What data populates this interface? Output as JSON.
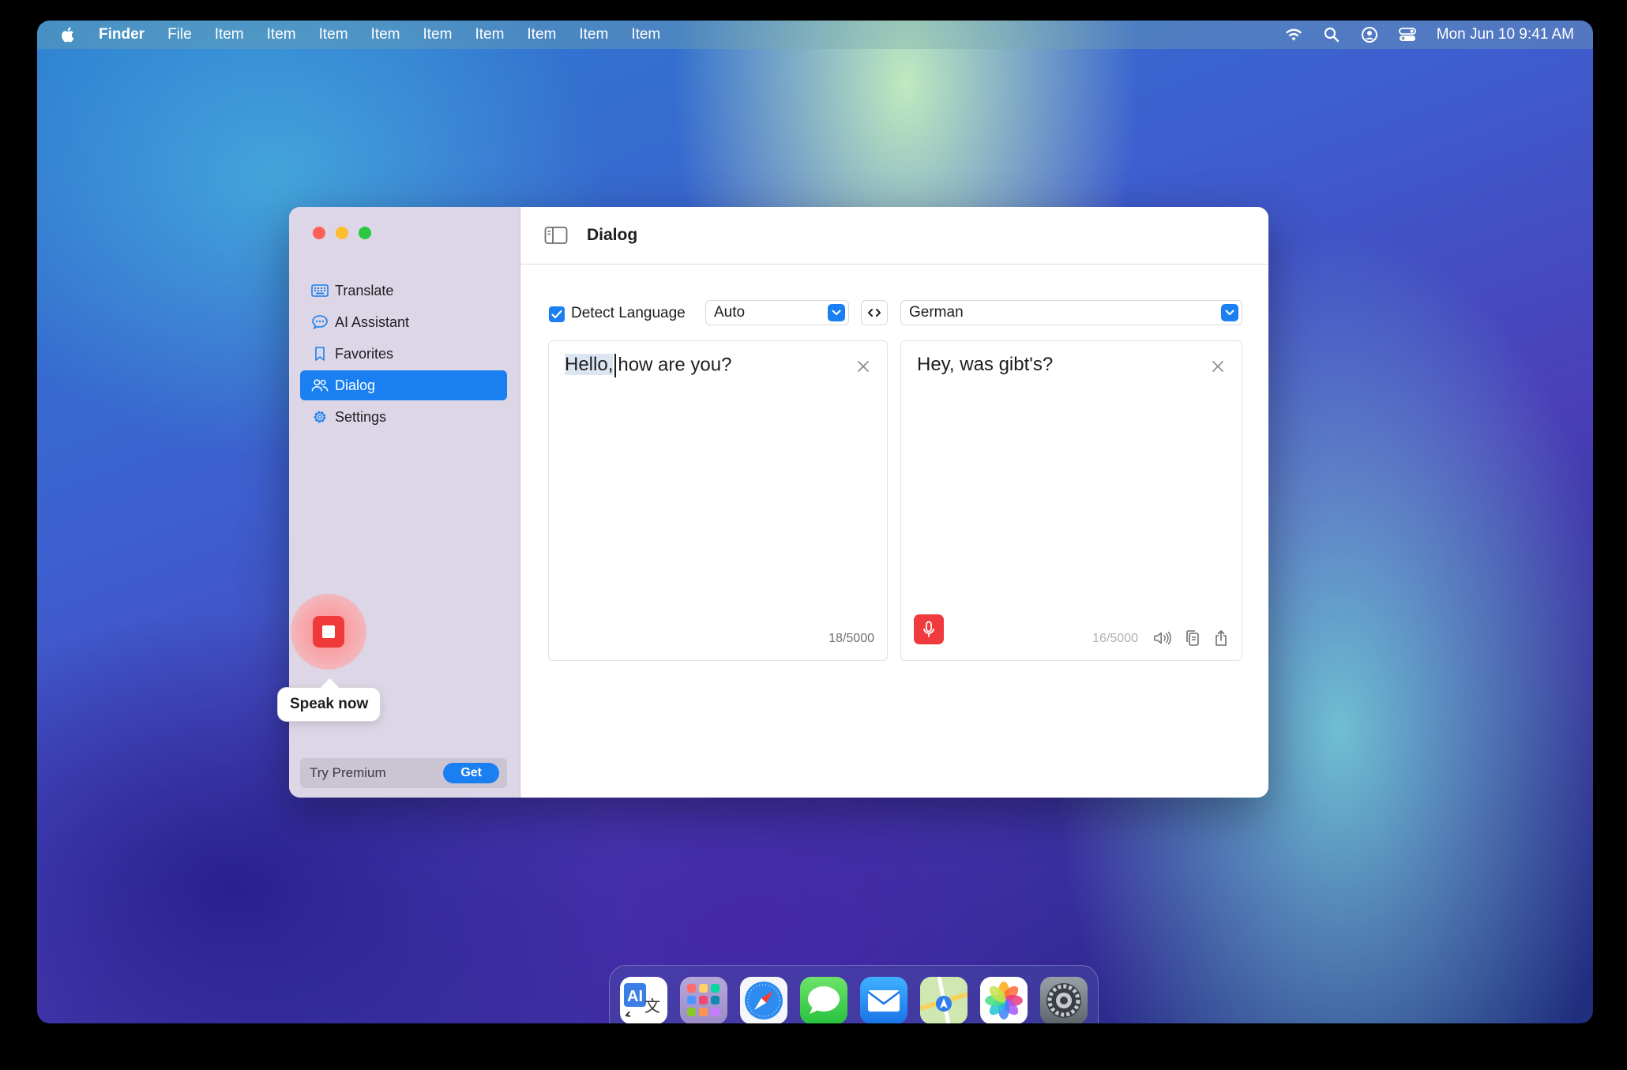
{
  "menubar": {
    "app_name": "Finder",
    "items": [
      "File",
      "Item",
      "Item",
      "Item",
      "Item",
      "Item",
      "Item",
      "Item",
      "Item",
      "Item"
    ],
    "clock": "Mon Jun 10  9:41 AM"
  },
  "window": {
    "title": "Dialog",
    "sidebar": {
      "items": [
        {
          "label": "Translate",
          "icon": "keyboard-icon"
        },
        {
          "label": "AI Assistant",
          "icon": "chat-bubble-icon"
        },
        {
          "label": "Favorites",
          "icon": "bookmark-icon"
        },
        {
          "label": "Dialog",
          "icon": "people-icon",
          "active": true
        },
        {
          "label": "Settings",
          "icon": "gear-icon"
        }
      ],
      "premium": {
        "label": "Try Premium",
        "button": "Get"
      }
    },
    "languages": {
      "detect_label": "Detect Language",
      "detect_checked": true,
      "source": "Auto",
      "target": "German"
    },
    "source_panel": {
      "highlighted": "Hello,",
      "rest": "how are you?",
      "count": "18/5000"
    },
    "target_panel": {
      "text": "Hey, was gibt's?",
      "count": "16/5000"
    },
    "tooltip": "Speak now"
  },
  "dock": {
    "apps": [
      "translate-app-icon",
      "launchpad-icon",
      "safari-icon",
      "messages-icon",
      "mail-icon",
      "maps-icon",
      "photos-icon",
      "system-settings-icon"
    ]
  },
  "colors": {
    "accent": "#1a7ff0",
    "record": "#f0393b"
  }
}
